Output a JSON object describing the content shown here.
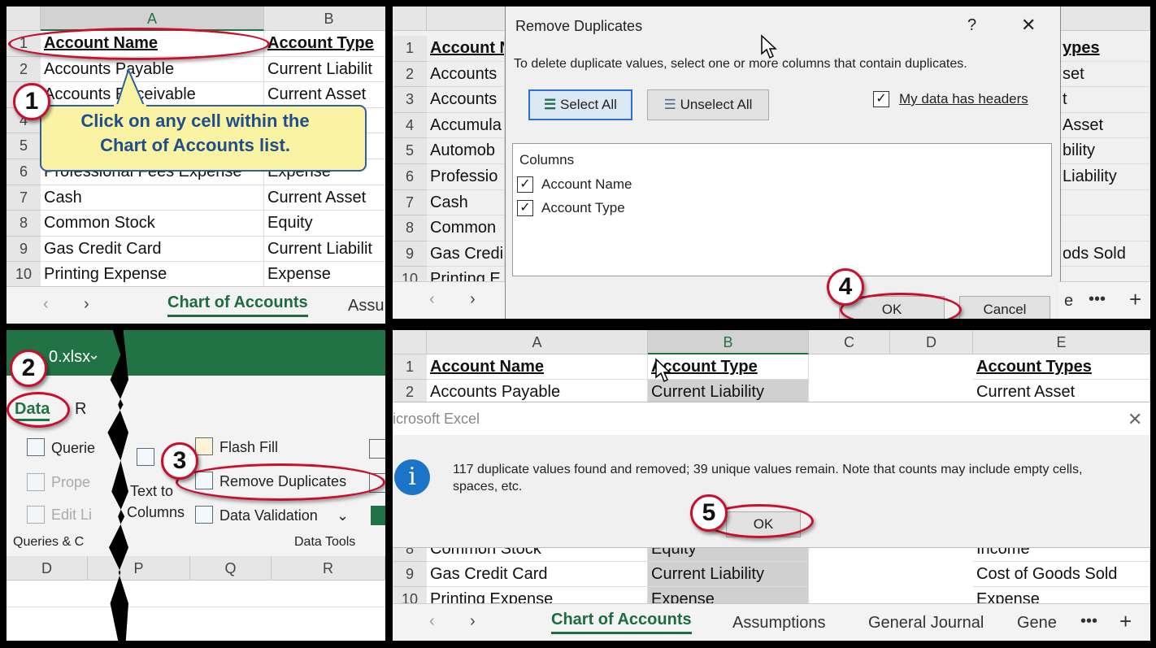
{
  "p1": {
    "col_a": "A",
    "col_b": "B",
    "rows": [
      {
        "n": "1",
        "a": "Account Name",
        "b": "Account Type"
      },
      {
        "n": "2",
        "a": "Accounts Payable",
        "b": "Current Liabilit"
      },
      {
        "n": "3",
        "a": "Accounts Receivable",
        "b": "Current Asset"
      },
      {
        "n": "4",
        "a": "",
        "b": ""
      },
      {
        "n": "5",
        "a": "",
        "b": ""
      },
      {
        "n": "6",
        "a": "Professional Fees Expense",
        "b": "Expense"
      },
      {
        "n": "7",
        "a": "Cash",
        "b": "Current Asset"
      },
      {
        "n": "8",
        "a": "Common Stock",
        "b": "Equity"
      },
      {
        "n": "9",
        "a": "Gas Credit Card",
        "b": "Current Liabilit"
      },
      {
        "n": "10",
        "a": "Printing Expense",
        "b": "Expense"
      }
    ],
    "callout": "Click on any cell within the Chart of Accounts list.",
    "step": "1",
    "tab_active": "Chart of Accounts",
    "tab_next": "Assu"
  },
  "p2": {
    "dialog_title": "Remove Duplicates",
    "help": "?",
    "close": "✕",
    "instructions": "To delete duplicate values, select one or more columns that contain duplicates.",
    "select_all": "Select All",
    "unselect_all": "Unselect All",
    "headers_label": "My data has headers",
    "columns_label": "Columns",
    "col1": "Account Name",
    "col2": "Account Type",
    "ok": "OK",
    "cancel": "Cancel",
    "step": "4",
    "bg_rows": [
      {
        "n": "1",
        "a": "Account N",
        "e": "ypes"
      },
      {
        "n": "2",
        "a": "Accounts",
        "e": "set"
      },
      {
        "n": "3",
        "a": "Accounts",
        "e": "t"
      },
      {
        "n": "4",
        "a": "Accumula",
        "e": "Asset"
      },
      {
        "n": "5",
        "a": "Automob",
        "e": "bility"
      },
      {
        "n": "6",
        "a": "Professio",
        "e": "Liability"
      },
      {
        "n": "7",
        "a": "Cash",
        "e": ""
      },
      {
        "n": "8",
        "a": "Common",
        "e": ""
      },
      {
        "n": "9",
        "a": "Gas Credi",
        "e": "ods Sold"
      },
      {
        "n": "10",
        "a": "Printing E",
        "e": ""
      }
    ],
    "tab_partial": "e",
    "more": "•••",
    "plus": "+"
  },
  "p3": {
    "filename": "0.xlsx",
    "tab_data": "Data",
    "tab_r": "R",
    "queries": "Querie",
    "properties": "Prope",
    "edit_links": "Edit Li",
    "queries_group": "Queries & C",
    "text_to": "Text to",
    "columns": "Columns",
    "flash_fill": "Flash Fill",
    "remove_duplicates": "Remove Duplicates",
    "data_validation": "Data Validation",
    "data_tools": "Data Tools",
    "cols": [
      "D",
      "P",
      "Q",
      "R"
    ],
    "step2": "2",
    "step3": "3"
  },
  "p4": {
    "cols": [
      "A",
      "B",
      "C",
      "D",
      "E"
    ],
    "row1": {
      "n": "1",
      "a": "Account Name",
      "b": "Account Type",
      "e": "Account Types"
    },
    "row2": {
      "n": "2",
      "a": "Accounts Payable",
      "b": "Current Liability",
      "e": "Current Asset"
    },
    "row8": {
      "n": "8",
      "a": "Common Stock",
      "b": "Equity",
      "e": "Income"
    },
    "row9": {
      "n": "9",
      "a": "Gas Credit Card",
      "b": "Current Liability",
      "e": "Cost of Goods Sold"
    },
    "row10": {
      "n": "10",
      "a": "Printing Expense",
      "b": "Expense",
      "e": "Expense"
    },
    "msg_title": "icrosoft Excel",
    "msg_text": "117 duplicate values found and removed; 39 unique values remain. Note that counts may include empty cells, spaces, etc.",
    "info_glyph": "i",
    "ok": "OK",
    "step": "5",
    "tabs": [
      "Chart of Accounts",
      "Assumptions",
      "General Journal",
      "Gene"
    ],
    "more": "•••",
    "plus": "+"
  },
  "colors": {
    "excel_green": "#217346",
    "red_annotation": "#c8102e",
    "callout_yellow": "#fbf3a4",
    "info_blue": "#1b74c6"
  }
}
